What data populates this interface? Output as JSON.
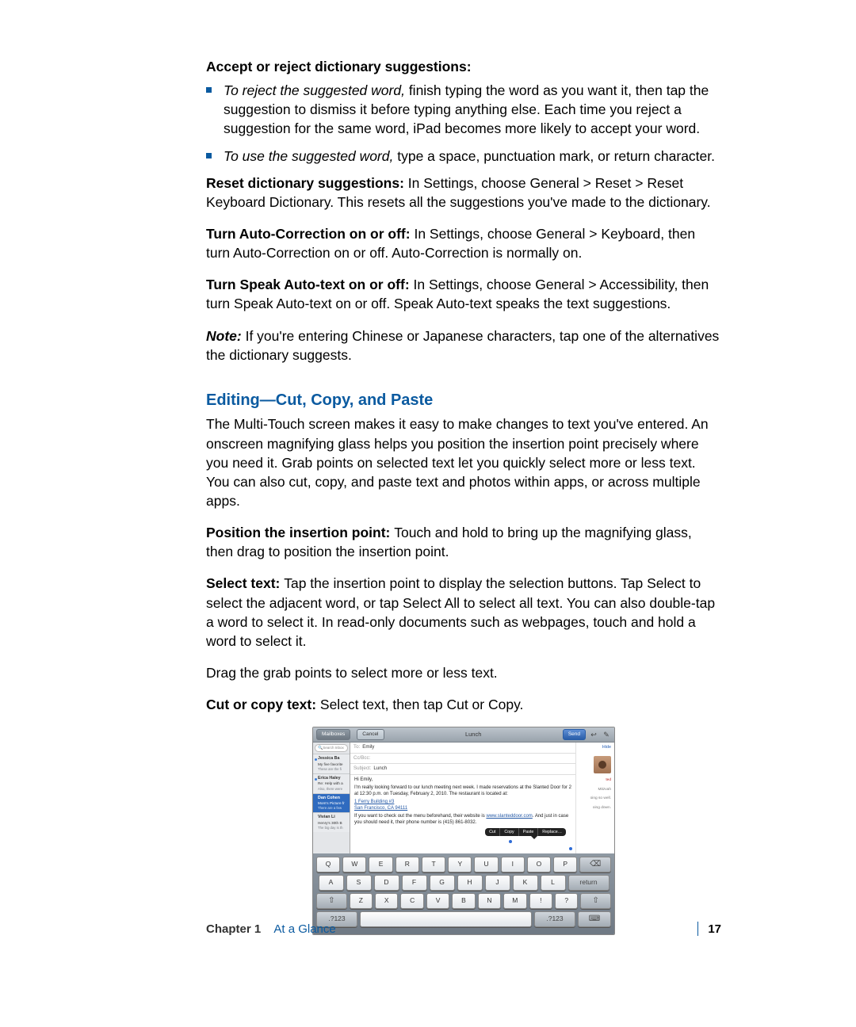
{
  "heading_accept_reject": "Accept or reject dictionary suggestions:",
  "bullets": [
    {
      "lead": "To reject the suggested word, ",
      "rest": "finish typing the word as you want it, then tap the suggestion to dismiss it before typing anything else. Each time you reject a suggestion for the same word, iPad becomes more likely to accept your word."
    },
    {
      "lead": "To use the suggested word, ",
      "rest": "type a space, punctuation mark, or return character."
    }
  ],
  "p_reset_lead": "Reset dictionary suggestions:  ",
  "p_reset_rest": "In Settings, choose General > Reset > Reset Keyboard Dictionary. This resets all the suggestions you've made to the dictionary.",
  "p_ac_lead": "Turn Auto-Correction on or off:  ",
  "p_ac_rest": "In Settings, choose General > Keyboard, then turn Auto-Correction on or off. Auto-Correction is normally on.",
  "p_speak_lead": "Turn Speak Auto-text on or off:  ",
  "p_speak_rest": "In Settings, choose General > Accessibility, then turn Speak Auto-text on or off. Speak Auto-text speaks the text suggestions.",
  "p_note_lead": "Note:  ",
  "p_note_rest": "If you're entering Chinese or Japanese characters, tap one of the alternatives the dictionary suggests.",
  "subhead_editing": "Editing—Cut, Copy, and Paste",
  "p_edit_intro": "The Multi-Touch screen makes it easy to make changes to text you've entered. An onscreen magnifying glass helps you position the insertion point precisely where you need it. Grab points on selected text let you quickly select more or less text. You can also cut, copy, and paste text and photos within apps, or across multiple apps.",
  "p_position_lead": "Position the insertion point:  ",
  "p_position_rest": "Touch and hold to bring up the magnifying glass, then drag to position the insertion point.",
  "p_select_lead": "Select text:  ",
  "p_select_rest": "Tap the insertion point to display the selection buttons. Tap Select to select the adjacent word, or tap Select All to select all text. You can also double-tap a word to select it. In read-only documents such as webpages, touch and hold a word to select it.",
  "p_drag": "Drag the grab points to select more or less text.",
  "p_cutcopy_lead": "Cut or copy text:  ",
  "p_cutcopy_rest": "Select text, then tap Cut or Copy.",
  "footer": {
    "chapter_label": "Chapter 1",
    "chapter_title": "At a Glance",
    "page": "17"
  },
  "ipad": {
    "back_btn": "Mailboxes",
    "cancel_btn": "Cancel",
    "title": "Lunch",
    "send_btn": "Send",
    "hide_label": "Hide",
    "search_placeholder": "Search Inbox",
    "messages": [
      {
        "from": "Jessica Ba",
        "subj": "My five favorite",
        "prev": "These are the fi",
        "unread": true
      },
      {
        "from": "Erica Haley",
        "subj": "Re: Help with a",
        "prev": "Also, there were",
        "unread": true
      },
      {
        "from": "Dan Cohen",
        "subj": "Mom's Picture fr",
        "prev": "There are a few",
        "unread": false,
        "sel": true
      },
      {
        "from": "Vivian Li",
        "subj": "Henry's 30th B",
        "prev": "The big day is th",
        "unread": false
      }
    ],
    "fields": {
      "to_label": "To:",
      "to_val": "Emily",
      "cc_label": "Cc/Bcc:",
      "subj_label": "Subject:",
      "subj_val": "Lunch"
    },
    "body": {
      "greet": "Hi Emily,",
      "p1": "I'm really looking forward to our lunch meeting next week. I made reservations at the Slanted Door for 2 at 12:30 p.m. on Tuesday, February 2, 2010. The restaurant is located at:",
      "addr1": "1 Ferry Building #3",
      "addr2": "San Francisco, CA 94111",
      "p2a": "If you want to check out the menu beforehand, their website is ",
      "link": "www.slanteddoor.com",
      "p2b": ". And just in case you should need it, their phone number is (415) 861-8032."
    },
    "popup": {
      "cut": "Cut",
      "copy": "Copy",
      "paste": "Paste",
      "replace": "Replace…"
    },
    "rightcol": {
      "txt1": "Mitzvah",
      "txt2": "oing so well.",
      "txt3": "oing down."
    },
    "keyboard": {
      "r1": [
        "Q",
        "W",
        "E",
        "R",
        "T",
        "Y",
        "U",
        "I",
        "O",
        "P"
      ],
      "r2": [
        "A",
        "S",
        "D",
        "F",
        "G",
        "H",
        "J",
        "K",
        "L"
      ],
      "r3": [
        "Z",
        "X",
        "C",
        "V",
        "B",
        "N",
        "M",
        "!",
        "?"
      ],
      "num": ".?123",
      "return": "return",
      "backspace": "⌫",
      "shift": "⇧"
    }
  }
}
